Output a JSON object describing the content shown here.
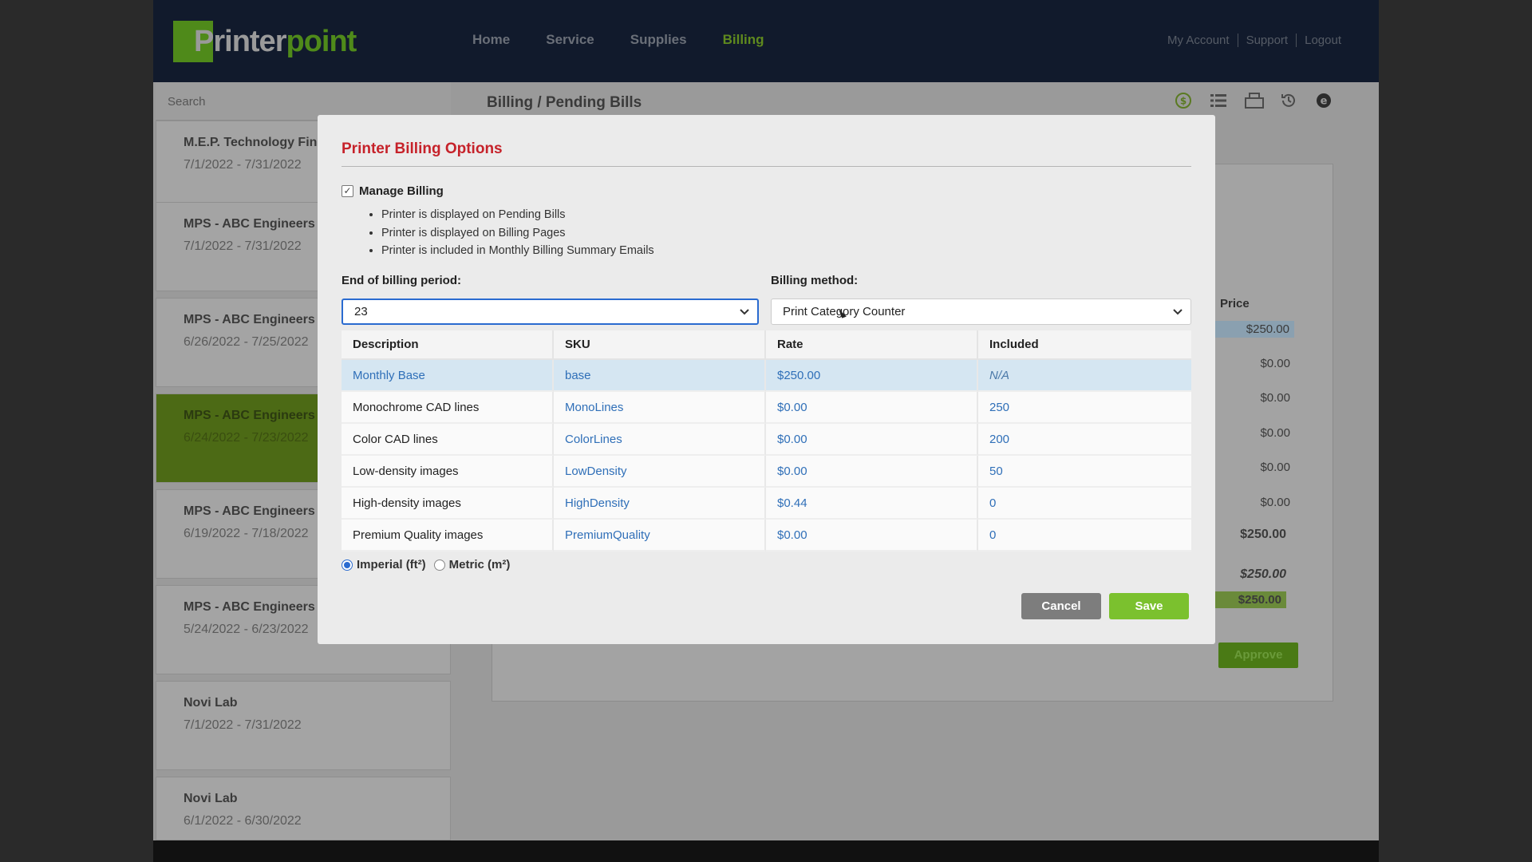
{
  "brand": {
    "part1": "Printer",
    "part2": "point"
  },
  "nav": [
    {
      "label": "Home",
      "active": false
    },
    {
      "label": "Service",
      "active": false
    },
    {
      "label": "Supplies",
      "active": false
    },
    {
      "label": "Billing",
      "active": true
    }
  ],
  "toplinks": [
    "My Account",
    "Support",
    "Logout"
  ],
  "search": {
    "placeholder": "Search"
  },
  "bills": [
    {
      "name": "M.E.P. Technology Fin",
      "dates": "7/1/2022 - 7/31/2022",
      "active": false
    },
    {
      "name": "MPS - ABC Engineers",
      "dates": "7/1/2022 - 7/31/2022",
      "active": false
    },
    {
      "name": "MPS - ABC Engineers",
      "dates": "6/26/2022 - 7/25/2022",
      "active": false
    },
    {
      "name": "MPS - ABC Engineers",
      "dates": "6/24/2022 - 7/23/2022",
      "active": true
    },
    {
      "name": "MPS - ABC Engineers",
      "dates": "6/19/2022 - 7/18/2022",
      "active": false
    },
    {
      "name": "MPS - ABC Engineers",
      "dates": "5/24/2022 - 6/23/2022",
      "active": false
    },
    {
      "name": "Novi Lab",
      "dates": "7/1/2022 - 7/31/2022",
      "active": false
    },
    {
      "name": "Novi Lab",
      "dates": "6/1/2022 - 6/30/2022",
      "active": false
    }
  ],
  "page_title": "Billing / Pending Bills",
  "toolbar_icons": [
    "dollar-icon",
    "list-icon",
    "printer-icon",
    "history-icon",
    "e-icon"
  ],
  "background": {
    "price_label": "Price",
    "prices": [
      "$250.00",
      "$0.00",
      "$0.00",
      "$0.00",
      "$0.00",
      "$0.00",
      "$250.00",
      "$250.00",
      "$250.00"
    ],
    "approve_label": "Approve"
  },
  "modal": {
    "title": "Printer Billing Options",
    "manage_billing": {
      "label": "Manage Billing",
      "checked": true
    },
    "bullets": [
      "Printer is displayed on Pending Bills",
      "Printer is displayed on Billing Pages",
      "Printer is included in Monthly Billing Summary Emails"
    ],
    "end_period": {
      "label": "End of billing period:",
      "value": "23"
    },
    "billing_method": {
      "label": "Billing method:",
      "value": "Print Category Counter"
    },
    "table": {
      "headers": [
        "Description",
        "SKU",
        "Rate",
        "Included"
      ],
      "rows": [
        {
          "description": "Monthly Base",
          "sku": "base",
          "rate": "$250.00",
          "included": "N/A"
        },
        {
          "description": "Monochrome CAD lines",
          "sku": "MonoLines",
          "rate": "$0.00",
          "included": "250"
        },
        {
          "description": "Color CAD lines",
          "sku": "ColorLines",
          "rate": "$0.00",
          "included": "200"
        },
        {
          "description": "Low-density images",
          "sku": "LowDensity",
          "rate": "$0.00",
          "included": "50"
        },
        {
          "description": "High-density images",
          "sku": "HighDensity",
          "rate": "$0.44",
          "included": "0"
        },
        {
          "description": "Premium Quality images",
          "sku": "PremiumQuality",
          "rate": "$0.00",
          "included": "0"
        }
      ]
    },
    "units": {
      "imperial": "Imperial (ft²)",
      "metric": "Metric (m²)",
      "selected": "imperial"
    },
    "cancel_label": "Cancel",
    "save_label": "Save"
  }
}
